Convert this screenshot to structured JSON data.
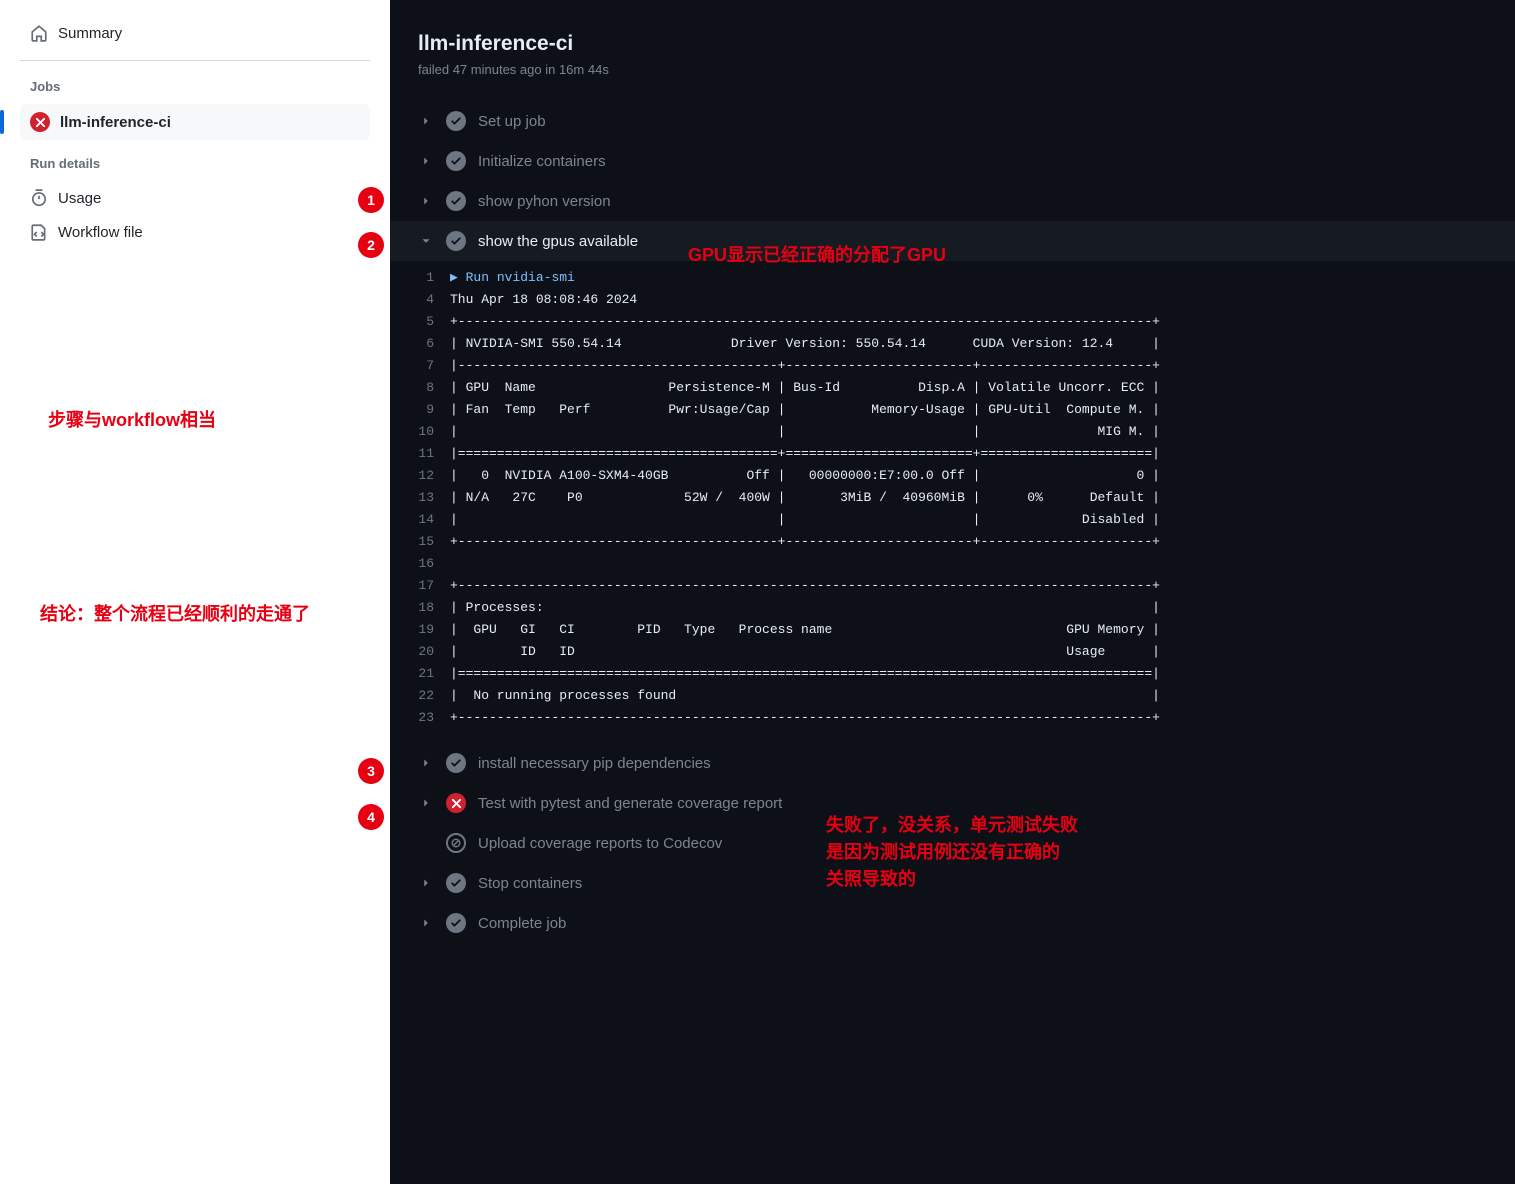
{
  "sidebar": {
    "summary": "Summary",
    "jobs_heading": "Jobs",
    "job_name": "llm-inference-ci",
    "run_details_heading": "Run details",
    "usage": "Usage",
    "workflow_file": "Workflow file"
  },
  "header": {
    "title": "llm-inference-ci",
    "status_word": "failed",
    "time_ago": "47 minutes ago",
    "duration": "16m 44s"
  },
  "steps": [
    {
      "label": "Set up job",
      "status": "ok",
      "expanded": false
    },
    {
      "label": "Initialize containers",
      "status": "ok",
      "expanded": false
    },
    {
      "label": "show pyhon version",
      "status": "ok",
      "expanded": false
    },
    {
      "label": "show the gpus available",
      "status": "ok",
      "expanded": true
    },
    {
      "label": "install necessary pip dependencies",
      "status": "ok",
      "expanded": false
    },
    {
      "label": "Test with pytest and generate coverage report",
      "status": "fail",
      "expanded": false
    },
    {
      "label": "Upload coverage reports to Codecov",
      "status": "skip",
      "expanded": false
    },
    {
      "label": "Stop containers",
      "status": "ok",
      "expanded": false
    },
    {
      "label": "Complete job",
      "status": "ok",
      "expanded": false
    }
  ],
  "log": [
    {
      "n": "1",
      "cmd": true,
      "t": "▶ Run nvidia-smi"
    },
    {
      "n": "4",
      "t": "Thu Apr 18 08:08:46 2024"
    },
    {
      "n": "5",
      "t": "+-----------------------------------------------------------------------------------------+"
    },
    {
      "n": "6",
      "t": "| NVIDIA-SMI 550.54.14              Driver Version: 550.54.14      CUDA Version: 12.4     |"
    },
    {
      "n": "7",
      "t": "|-----------------------------------------+------------------------+----------------------+"
    },
    {
      "n": "8",
      "t": "| GPU  Name                 Persistence-M | Bus-Id          Disp.A | Volatile Uncorr. ECC |"
    },
    {
      "n": "9",
      "t": "| Fan  Temp   Perf          Pwr:Usage/Cap |           Memory-Usage | GPU-Util  Compute M. |"
    },
    {
      "n": "10",
      "t": "|                                         |                        |               MIG M. |"
    },
    {
      "n": "11",
      "t": "|=========================================+========================+======================|"
    },
    {
      "n": "12",
      "t": "|   0  NVIDIA A100-SXM4-40GB          Off |   00000000:E7:00.0 Off |                    0 |"
    },
    {
      "n": "13",
      "t": "| N/A   27C    P0             52W /  400W |       3MiB /  40960MiB |      0%      Default |"
    },
    {
      "n": "14",
      "t": "|                                         |                        |             Disabled |"
    },
    {
      "n": "15",
      "t": "+-----------------------------------------+------------------------+----------------------+"
    },
    {
      "n": "16",
      "t": ""
    },
    {
      "n": "17",
      "t": "+-----------------------------------------------------------------------------------------+"
    },
    {
      "n": "18",
      "t": "| Processes:                                                                              |"
    },
    {
      "n": "19",
      "t": "|  GPU   GI   CI        PID   Type   Process name                              GPU Memory |"
    },
    {
      "n": "20",
      "t": "|        ID   ID                                                               Usage      |"
    },
    {
      "n": "21",
      "t": "|=========================================================================================|"
    },
    {
      "n": "22",
      "t": "|  No running processes found                                                             |"
    },
    {
      "n": "23",
      "t": "+-----------------------------------------------------------------------------------------+"
    }
  ],
  "annotations": {
    "gpu": "GPU显示已经正确的分配了GPU",
    "steps_note": "步骤与workflow相当",
    "conclusion": "结论：整个流程已经顺利的走通了",
    "fail_note_1": "失败了，没关系，单元测试失败",
    "fail_note_2": "是因为测试用例还没有正确的",
    "fail_note_3": "关照导致的",
    "b1": "1",
    "b2": "2",
    "b3": "3",
    "b4": "4"
  }
}
